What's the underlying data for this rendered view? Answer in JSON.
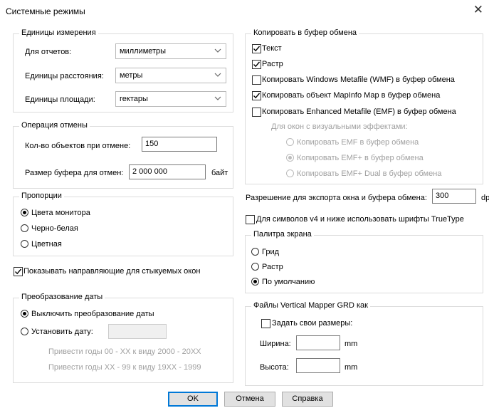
{
  "window": {
    "title": "Системные режимы",
    "close_label": "✕"
  },
  "units": {
    "title": "Единицы измерения",
    "reports_label": "Для отчетов:",
    "reports_value": "миллиметры",
    "distance_label": "Единицы расстояния:",
    "distance_value": "метры",
    "area_label": "Единицы площади:",
    "area_value": "гектары"
  },
  "undo": {
    "title": "Операция отмены",
    "count_label": "Кол-во объектов при отмене:",
    "count_value": "150",
    "buffer_label": "Размер буфера для отмен:",
    "buffer_value": "2 000 000",
    "buffer_unit": "байт"
  },
  "proportions": {
    "title": "Пропорции",
    "options": [
      "Цвета монитора",
      "Черно-белая",
      "Цветная"
    ],
    "selected": 0
  },
  "guides": {
    "label": "Показывать направляющие для стыкуемых окон",
    "checked": true
  },
  "dates": {
    "title": "Преобразование даты",
    "disable_label": "Выключить преобразование даты",
    "set_label": "Установить дату:",
    "set_value": "",
    "hint1": "Привести годы 00 - XX к виду 2000 - 20XX",
    "hint2": "Привести годы XX - 99 к виду 19XX - 1999"
  },
  "clipboard": {
    "title": "Копировать в буфер обмена",
    "text_label": "Текст",
    "text_checked": true,
    "raster_label": "Растр",
    "raster_checked": true,
    "wmf_label": "Копировать Windows Metafile (WMF) в буфер обмена",
    "wmf_checked": false,
    "mapinfo_label": "Копировать объект MapInfo Map в буфер обмена",
    "mapinfo_checked": true,
    "emf_label": "Копировать Enhanced Metafile (EMF) в буфер обмена",
    "emf_checked": false,
    "visual_title": "Для окон с визуальными эффектами:",
    "visual_options": [
      "Копировать EMF в буфер обмена",
      "Копировать EMF+ в буфер обмена",
      "Копировать EMF+ Dual в буфер обмена"
    ],
    "visual_selected": 1
  },
  "resolution": {
    "label": "Разрешение для экспорта окна и буфера обмена:",
    "value": "300",
    "unit": "dp"
  },
  "truetype": {
    "label": "Для символов v4 и ниже использовать шрифты TrueType",
    "checked": false
  },
  "palette": {
    "title": "Палитра экрана",
    "options": [
      "Грид",
      "Растр",
      "По умолчанию"
    ],
    "selected": 2
  },
  "vm": {
    "title": "Файлы Vertical Mapper GRD как",
    "custom_label": "Задать свои размеры:",
    "custom_checked": false,
    "width_label": "Ширина:",
    "width_value": "",
    "width_unit": "mm",
    "height_label": "Высота:",
    "height_value": "",
    "height_unit": "mm"
  },
  "buttons": {
    "ok": "OK",
    "cancel": "Отмена",
    "help": "Справка"
  }
}
